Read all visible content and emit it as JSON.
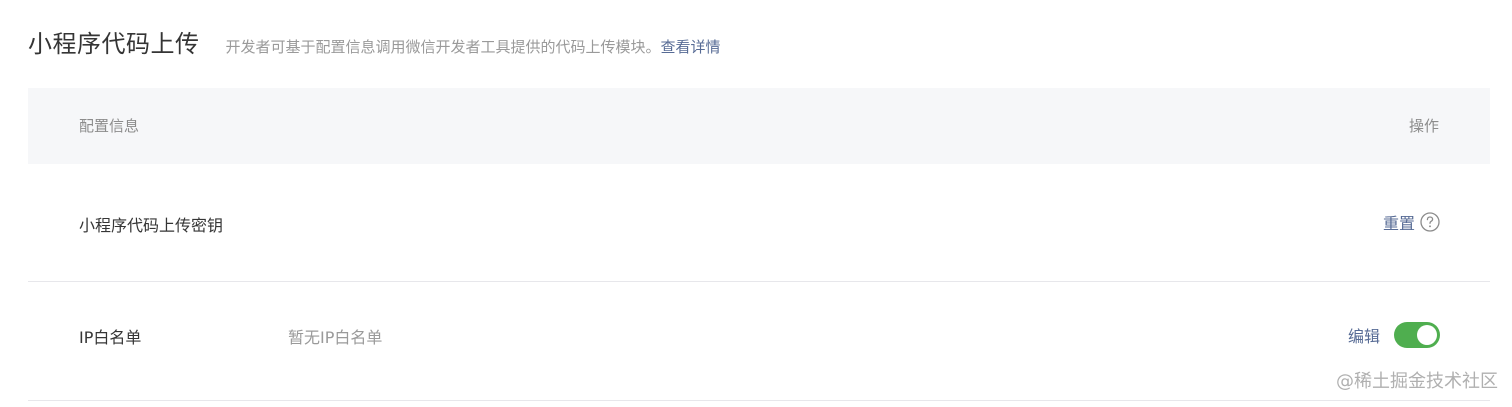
{
  "header": {
    "title": "小程序代码上传",
    "description": "开发者可基于配置信息调用微信开发者工具提供的代码上传模块。",
    "details_link": "查看详情"
  },
  "table": {
    "columns": {
      "config": "配置信息",
      "action": "操作"
    },
    "rows": [
      {
        "label": "小程序代码上传密钥",
        "value": "",
        "action": "重置",
        "icon": "help-icon"
      },
      {
        "label": "IP白名单",
        "value": "暂无IP白名单",
        "action": "编辑",
        "toggle_on": true
      }
    ]
  },
  "watermark": "@稀土掘金技术社区",
  "colors": {
    "link": "#576b95",
    "toggle_on": "#4fae4f",
    "header_bg": "#f6f7f9"
  }
}
